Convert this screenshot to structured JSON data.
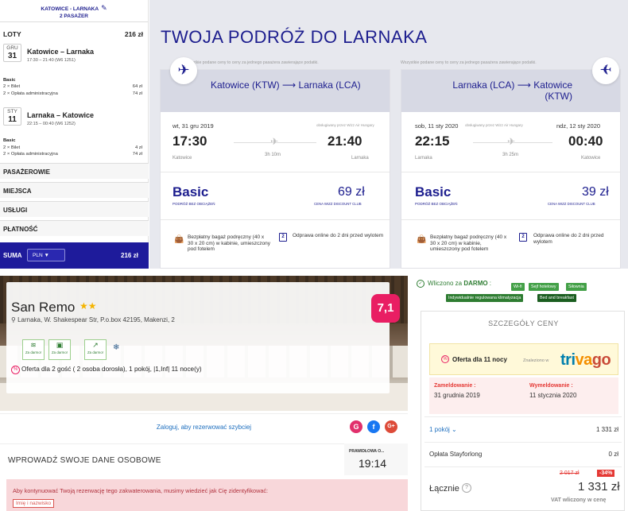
{
  "wizz": {
    "header": {
      "route": "KATOWICE - LARNAKA",
      "passengers": "2 PASAŻER"
    },
    "sidebar": {
      "loty_label": "LOTY",
      "loty_total": "216 zł",
      "flights": [
        {
          "month": "GRU",
          "day": "31",
          "route": "Katowice – Larnaka",
          "times": "17:30 – 21:40 (W6 1251)",
          "fare": "Basic",
          "lines": [
            {
              "label": "2 × Bilet",
              "value": "64 zł"
            },
            {
              "label": "2 × Opłata administracyjna",
              "value": "74 zł"
            }
          ]
        },
        {
          "month": "STY",
          "day": "11",
          "route": "Larnaka – Katowice",
          "times": "22:15 – 00:40 (W6 1252)",
          "fare": "Basic",
          "lines": [
            {
              "label": "2 × Bilet",
              "value": "4 zł"
            },
            {
              "label": "2 × Opłata administracyjna",
              "value": "74 zł"
            }
          ]
        }
      ],
      "sections": [
        "PASAŻEROWIE",
        "MIEJSCA",
        "USŁUGI",
        "PŁATNOŚĆ"
      ],
      "suma": {
        "label": "SUMA",
        "currency": "PLN ▼",
        "total": "216 zł"
      }
    },
    "title": "TWOJA PODRÓŻ DO LARNAKA",
    "note": "Wszystkie podane ceny to ceny za jednego pasażera zawierające podatki.",
    "cards": [
      {
        "route": "Katowice (KTW) ⟶ Larnaka (LCA)",
        "date": "wt, 31 gru 2019",
        "date2": "",
        "operator": "obsługiwany przez Wizz Air Hungary",
        "dep_time": "17:30",
        "dep_city": "Katowice",
        "duration": "3h 10m",
        "arr_time": "21:40",
        "arr_city": "Larnaka",
        "fare": "Basic",
        "fare_sub": "PODRÓŻ BEZ OBCIĄŻEŃ",
        "price": "69 zł",
        "price_sub": "CENA WIZZ DISCOUNT CLUB",
        "feature1": "Bezpłatny bagaż podręczny (40 x 30 x 20 cm) w kabinie, umieszczony pod fotelem",
        "feature2": "Odprawa online do 2 dni przed wylotem"
      },
      {
        "route": "Larnaka (LCA) ⟶ Katowice (KTW)",
        "date": "sob, 11 sty 2020",
        "date2": "ndz, 12 sty 2020",
        "operator": "obsługiwany przez Wizz Air Hungary",
        "dep_time": "22:15",
        "dep_city": "Larnaka",
        "duration": "3h 25m",
        "arr_time": "00:40",
        "arr_city": "Katowice",
        "fare": "Basic",
        "fare_sub": "PODRÓŻ BEZ OBCIĄŻEŃ",
        "price": "39 zł",
        "price_sub": "CENA WIZZ DISCOUNT CLUB",
        "feature1": "Bezpłatny bagaż podręczny (40 x 30 x 20 cm) w kabinie, umieszczony pod fotelem",
        "feature2": "Odprawa online do 2 dni przed wylotem"
      }
    ],
    "colors": {
      "brand": "#1c1d8e",
      "suma_bg": "#1e1b9b",
      "background": "#e7e8ee"
    }
  },
  "hotel": {
    "name": "San Remo",
    "stars": "★★",
    "address": "Larnaka, W. Shakespear Str, P.o.box 42195, Makenzi, 2",
    "score": "7,1",
    "amenity_label": "Za darmo!",
    "amenity_icons": [
      "wifi-icon",
      "safe-icon",
      "gym-icon",
      "ac-icon"
    ],
    "offer": "Oferta dla 2 gość ( 2 osoba dorosła), 1 pokój, |1,Inf| 11 noce(y)",
    "login": "Zaloguj, aby rezerwować szybciej",
    "social": [
      "G",
      "f",
      "G+"
    ],
    "form_title": "WPROWADŹ SWOJE DANE OSOBOWE",
    "timer_label": "PRAWIDŁOWA O...",
    "timer": "19:14",
    "alert": "Aby kontynuować Twoją rezerwację tego zakwaterowania, musimy wiedzieć jak Cię zidentyfikować:",
    "name_field": "Imię i nazwisko",
    "included_label": "Wliczono za",
    "included_bold": "DARMO",
    "tags": [
      "Wi-fi",
      "Sejf hotelowy",
      "Siłownia",
      "Indywidualnie regulowana klimatyzacja",
      "Bed and breakfast"
    ],
    "price": {
      "header": "SZCZEGÓŁY CENY",
      "offer": "Oferta dla 11 nocy",
      "found": "Znaleziono w",
      "brand": "trivago",
      "checkin_label": "Zameldowanie :",
      "checkin": "31 grudnia 2019",
      "checkout_label": "Wymeldowanie :",
      "checkout": "11 stycznia 2020",
      "room_label": "1 pokój",
      "room_value": "1 331 zł",
      "fee_label": "Opłata Stayforlong",
      "fee_value": "0 zł",
      "total_label": "Łącznie",
      "old_price": "2 017 zł",
      "discount": "-34%",
      "total_value": "1 331 zł",
      "vat": "VAT wliczony w cenę"
    },
    "colors": {
      "score": "#e91e63",
      "green": "#2e7d32",
      "alert_bg": "#f8d7da"
    }
  }
}
